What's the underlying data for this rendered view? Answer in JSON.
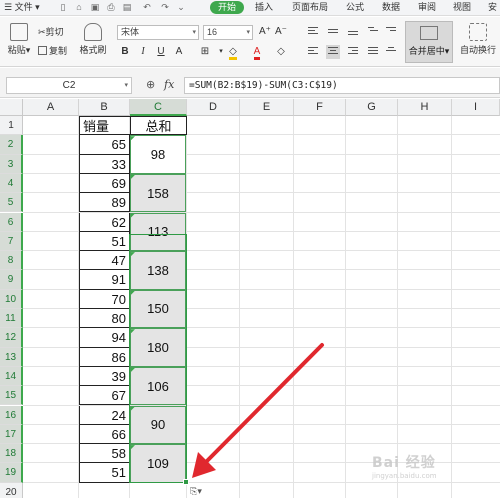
{
  "menubar": {
    "file": "文件",
    "tabs": [
      {
        "label": "开始",
        "active": true
      },
      {
        "label": "插入",
        "active": false
      },
      {
        "label": "页面布局",
        "active": false
      },
      {
        "label": "公式",
        "active": false
      },
      {
        "label": "数据",
        "active": false
      },
      {
        "label": "审阅",
        "active": false
      },
      {
        "label": "视图",
        "active": false
      },
      {
        "label": "安",
        "active": false
      }
    ]
  },
  "ribbon": {
    "paste": "粘贴",
    "cut": "剪切",
    "copy": "复制",
    "format_painter": "格式刷",
    "font_name": "宋体",
    "font_size": "16",
    "bold": "B",
    "italic": "I",
    "underline": "U",
    "grow_font": "A+",
    "shrink_font": "A-",
    "merge_center": "合并居中",
    "auto_wrap": "自动换行"
  },
  "formula_bar": {
    "name_box": "C2",
    "fx": "fx",
    "formula": "=SUM(B2:B$19)-SUM(C3:C$19)"
  },
  "sheet": {
    "columns": [
      "A",
      "B",
      "C",
      "D",
      "E",
      "F",
      "G",
      "H",
      "I"
    ],
    "rows": [
      "1",
      "2",
      "3",
      "4",
      "5",
      "6",
      "7",
      "8",
      "9",
      "10",
      "11",
      "12",
      "13",
      "14",
      "15",
      "16",
      "17",
      "18",
      "19",
      "20"
    ],
    "header_b": "销量",
    "header_c": "总和",
    "sales": [
      "65",
      "33",
      "69",
      "89",
      "62",
      "51",
      "47",
      "91",
      "70",
      "80",
      "94",
      "86",
      "39",
      "67",
      "24",
      "66",
      "58",
      "51"
    ],
    "totals": [
      "98",
      "158",
      "113",
      "138",
      "150",
      "180",
      "106",
      "90",
      "109"
    ]
  },
  "watermark": {
    "text": "Bai 经验",
    "sub": "jingyan.baidu.com"
  },
  "colors": {
    "accent": "#3ea84d",
    "selection_fill": "#e4e4e4",
    "arrow": "#e0282e"
  }
}
